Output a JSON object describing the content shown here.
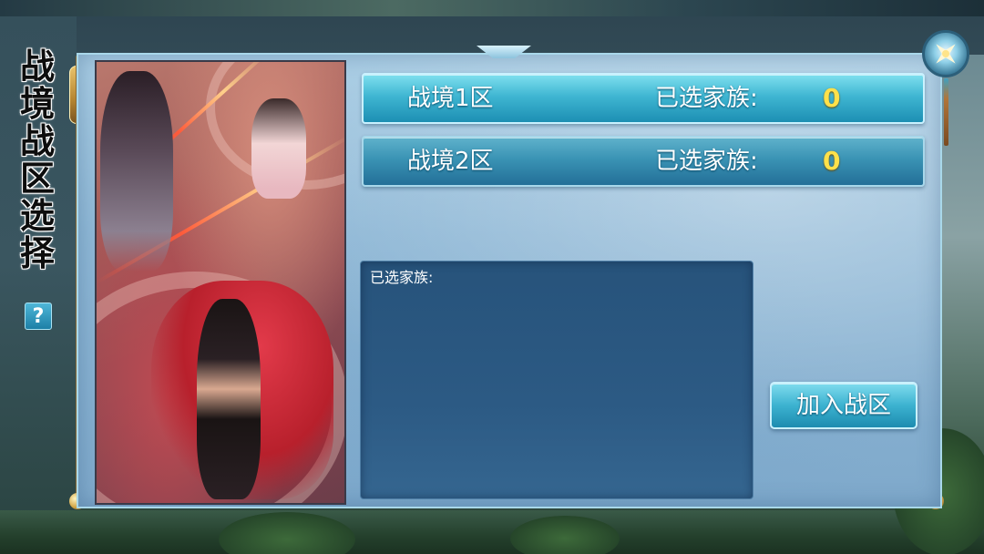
{
  "title": "战境战区选择",
  "help": {
    "label": "?"
  },
  "zones": [
    {
      "name": "战境1区",
      "selected_label": "已选家族:",
      "count": "0"
    },
    {
      "name": "战境2区",
      "selected_label": "已选家族:",
      "count": "0"
    }
  ],
  "families_panel": {
    "title": "已选家族:"
  },
  "join_button": {
    "label": "加入战区"
  },
  "colors": {
    "count_text": "#ffe14a",
    "button_top": "#7fdcee",
    "button_bottom": "#1d8cb0",
    "families_panel_bg": "#2c5a84"
  },
  "icons": {
    "close": "close-x-icon",
    "help": "question-mark-icon"
  }
}
